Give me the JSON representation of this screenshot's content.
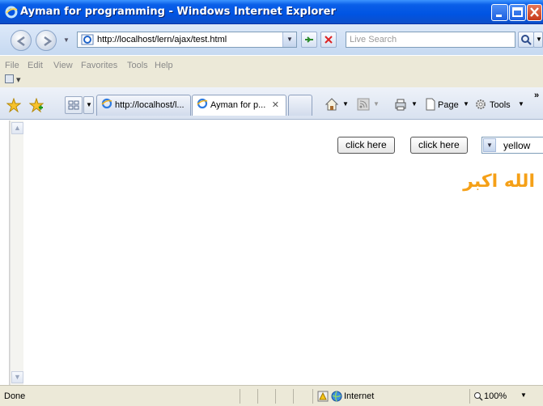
{
  "window": {
    "title": "Ayman for programming - Windows Internet Explorer"
  },
  "nav": {
    "address": "http://localhost/lern/ajax/test.html",
    "search_placeholder": "Live Search"
  },
  "menu": {
    "items": [
      "File",
      "Edit",
      "View",
      "Favorites",
      "Tools",
      "Help"
    ]
  },
  "tabs": {
    "items": [
      {
        "label": "http://localhost/l...",
        "active": false
      },
      {
        "label": "Ayman for p...",
        "active": true
      }
    ],
    "close_glyph": "✕"
  },
  "commands": {
    "page": "Page",
    "tools": "Tools",
    "more": "»"
  },
  "page": {
    "button1": "click here",
    "button2": "click here",
    "select_value": "yellow",
    "arabic_text": "الله اكبر",
    "arabic_color": "#f5a017"
  },
  "status": {
    "text": "Done",
    "zone": "Internet",
    "zoom": "100%"
  },
  "colors": {
    "titlebar": "#0054e3",
    "chrome": "#ece9d8"
  }
}
